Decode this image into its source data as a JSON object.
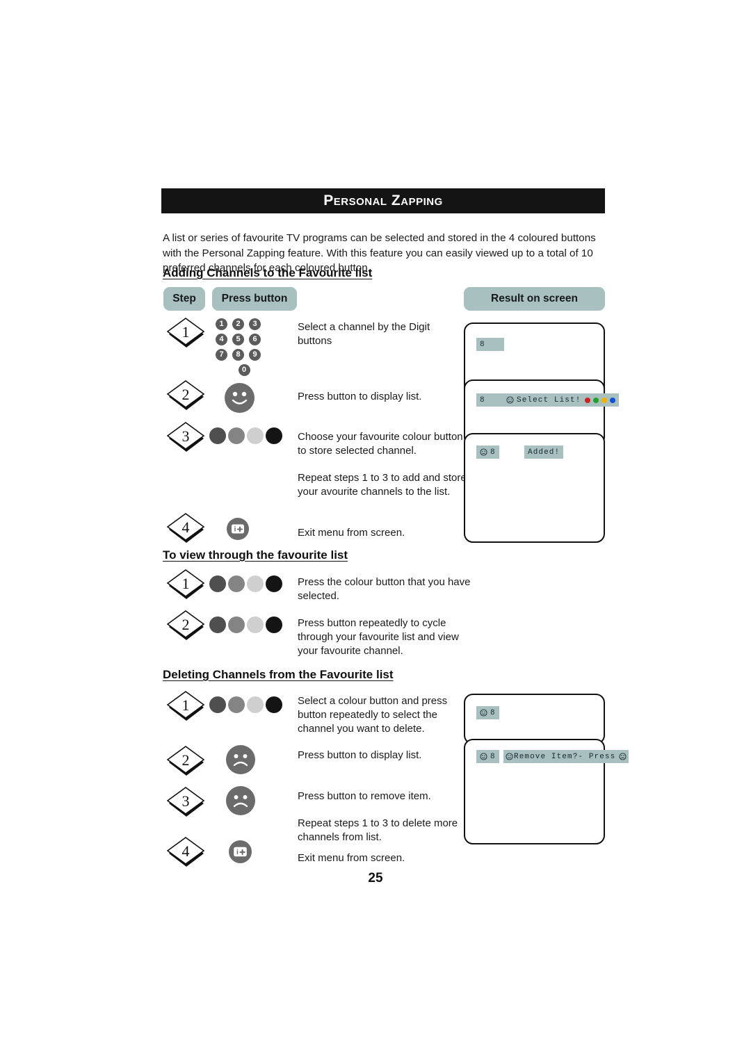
{
  "page": {
    "number": "25",
    "title": "Personal Zapping",
    "intro": "A list or series of favourite TV programs can be selected and stored in the 4 coloured buttons with the Personal Zapping feature. With this feature you can easily viewed up to a total of 10 preferred channels for each coloured button."
  },
  "columns": {
    "step": "Step",
    "press_button": "Press button",
    "result_on_screen": "Result on screen"
  },
  "sections": {
    "adding": {
      "heading": "Adding Channels to the Favourite list",
      "steps": [
        {
          "number": "1",
          "icon": "digit-keypad",
          "text": "Select a channel by the Digit buttons"
        },
        {
          "number": "2",
          "icon": "smiley-face-button",
          "text": "Press button to display list."
        },
        {
          "number": "3",
          "icon": "colour-button-row",
          "text": "Choose your favourite colour button to store selected channel."
        },
        {
          "number": "",
          "icon": "none",
          "text": "Repeat steps 1 to 3 to add and store your avourite channels to the list."
        },
        {
          "number": "4",
          "icon": "menu-exit-button",
          "text": "Exit menu from screen."
        }
      ]
    },
    "viewing": {
      "heading": "To view through the favourite list",
      "steps": [
        {
          "number": "1",
          "icon": "colour-button-row",
          "text": "Press the colour button that you have selected."
        },
        {
          "number": "2",
          "icon": "colour-button-row",
          "text": "Press button repeatedly to cycle through your favourite list and view your favourite channel."
        }
      ]
    },
    "deleting": {
      "heading": "Deleting Channels from the Favourite list",
      "steps": [
        {
          "number": "1",
          "icon": "colour-button-row",
          "text": "Select a colour button and press button repeatedly to select the channel you want to delete."
        },
        {
          "number": "2",
          "icon": "sad-face-button",
          "text": "Press button to display list."
        },
        {
          "number": "3",
          "icon": "sad-face-button",
          "text": "Press button to remove item."
        },
        {
          "number": "",
          "icon": "none",
          "text": "Repeat steps 1 to 3 to delete more channels from list."
        },
        {
          "number": "4",
          "icon": "menu-exit-button",
          "text": "Exit menu from screen."
        }
      ]
    }
  },
  "screens": {
    "adding": [
      {
        "name": "channel-only",
        "channel": "8",
        "message": "",
        "show_face": false,
        "show_colour_dots": false
      },
      {
        "name": "select-list",
        "channel": "8",
        "message": "Select List!",
        "show_face": true,
        "show_colour_dots": true
      },
      {
        "name": "added",
        "channel": "8",
        "message": "Added!",
        "show_face": true,
        "show_colour_dots": false
      }
    ],
    "deleting": [
      {
        "name": "channel-with-face",
        "channel": "8",
        "message": "",
        "show_face": true,
        "show_colour_dots": false
      },
      {
        "name": "remove-item-prompt",
        "channel": "8",
        "message": "Remove Item?- Press",
        "show_face": true,
        "show_colour_dots": false
      }
    ]
  },
  "colours": {
    "osd_background": "#a8c0c0",
    "banner_background": "#141414",
    "remote_button_grey": "#6b6b6b",
    "colour_buttons": [
      "#4f4f4f",
      "#848484",
      "#cfcfcf",
      "#141414"
    ],
    "osd_colour_dots": [
      "#cf1f1f",
      "#22a12a",
      "#f0b400",
      "#1250d4"
    ]
  },
  "icons": {
    "digits": [
      "1",
      "2",
      "3",
      "4",
      "5",
      "6",
      "7",
      "8",
      "9",
      "0"
    ],
    "smiley": "smiley-face-icon",
    "sad": "sad-face-icon",
    "menu_exit": "menu-exit-icon"
  }
}
